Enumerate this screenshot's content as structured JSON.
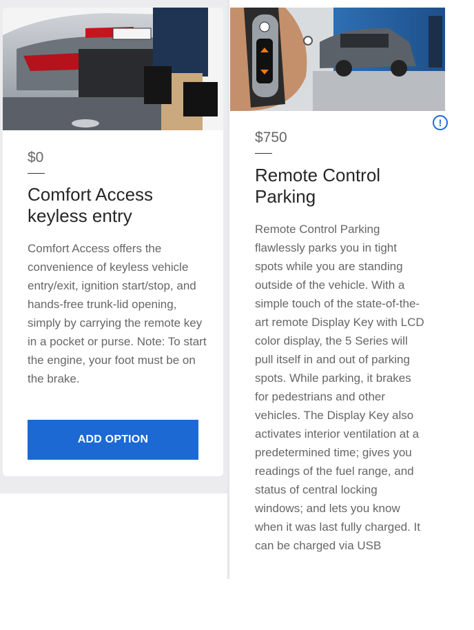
{
  "cards": [
    {
      "price": "$0",
      "title": "Comfort Access keyless entry",
      "description": "Comfort Access offers the convenience of keyless vehicle entry/exit, ignition start/stop, and hands-free trunk-lid opening, simply by carrying the remote key in a pocket or purse. Note: To start the engine, your foot must be on the brake.",
      "button_label": "ADD OPTION",
      "image": "car-trunk-photo"
    },
    {
      "price": "$750",
      "title": "Remote Control Parking",
      "description": "Remote Control Parking flawlessly parks you in tight spots while you are standing outside of the vehicle. With a simple touch of the state-of-the-art remote Display Key with LCD color display, the 5 Series will pull itself in and out of parking spots. While parking, it brakes for pedestrians and other vehicles. The Display Key also activates interior ventilation at a predetermined time; gives you readings of the fuel range, and status of central locking windows; and lets you know when it was last fully charged. It can be charged via USB",
      "image": "display-key-photo"
    }
  ],
  "info_icon": "!",
  "colors": {
    "accent": "#1c69d4",
    "page_bg": "#ececee"
  }
}
